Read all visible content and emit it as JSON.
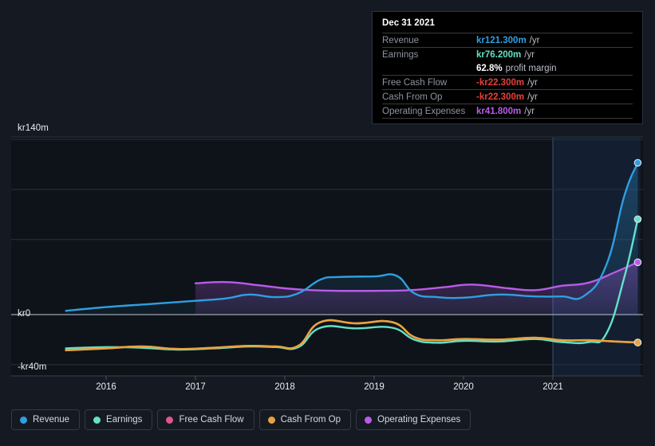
{
  "chart_data": {
    "type": "area",
    "title": "",
    "xlabel": "",
    "ylabel": "",
    "currency_prefix": "kr",
    "unit_suffix": "m",
    "ylim": [
      -40,
      140
    ],
    "xlim": [
      2015.55,
      2021.98
    ],
    "grid": true,
    "y_ticks": [
      {
        "value": 140,
        "label": "kr140m"
      },
      {
        "value": 100,
        "label": ""
      },
      {
        "value": 60,
        "label": ""
      },
      {
        "value": 0,
        "label": "kr0"
      },
      {
        "value": -40,
        "label": "-kr40m"
      }
    ],
    "x_ticks": [
      {
        "value": 2016,
        "label": "2016"
      },
      {
        "value": 2017,
        "label": "2017"
      },
      {
        "value": 2018,
        "label": "2018"
      },
      {
        "value": 2019,
        "label": "2019"
      },
      {
        "value": 2020,
        "label": "2020"
      },
      {
        "value": 2021,
        "label": "2021"
      }
    ],
    "highlight_band": {
      "from": 2021.0,
      "to": 2021.98
    },
    "legend_position": "bottom-left",
    "series": [
      {
        "name": "Revenue",
        "color": "#2E9FE0",
        "x": [
          2015.55,
          2016.0,
          2016.5,
          2017.0,
          2017.35,
          2017.6,
          2017.9,
          2018.15,
          2018.4,
          2018.6,
          2019.0,
          2019.25,
          2019.45,
          2019.7,
          2020.0,
          2020.4,
          2020.8,
          2021.1,
          2021.35,
          2021.6,
          2021.8,
          2021.95
        ],
        "values": [
          3.0,
          6.0,
          8.5,
          11.0,
          13.0,
          16.0,
          14.0,
          17.0,
          28.0,
          30.0,
          30.5,
          31.0,
          17.0,
          14.0,
          13.5,
          16.0,
          14.5,
          14.5,
          15.0,
          40.0,
          95.0,
          121.3
        ]
      },
      {
        "name": "Earnings",
        "color": "#63E2C6",
        "x": [
          2015.55,
          2016.0,
          2016.4,
          2016.8,
          2017.2,
          2017.6,
          2017.9,
          2018.15,
          2018.4,
          2018.8,
          2019.2,
          2019.45,
          2019.7,
          2020.0,
          2020.4,
          2020.8,
          2021.1,
          2021.4,
          2021.6,
          2021.8,
          2021.95
        ],
        "values": [
          -27.0,
          -26.0,
          -26.5,
          -28.0,
          -27.0,
          -25.5,
          -26.0,
          -26.0,
          -10.5,
          -11.0,
          -10.5,
          -20.0,
          -22.5,
          -21.0,
          -21.5,
          -19.5,
          -22.0,
          -22.0,
          -15.0,
          30.0,
          76.2
        ]
      },
      {
        "name": "Free Cash Flow",
        "color": "#E0558F",
        "x": [
          2015.55,
          2016.0,
          2016.4,
          2016.8,
          2017.2,
          2017.6,
          2017.9,
          2018.15,
          2018.4,
          2018.8,
          2019.2,
          2019.45,
          2019.7,
          2020.0,
          2020.4,
          2020.8,
          2021.1,
          2021.4,
          2021.7,
          2021.95
        ],
        "values": [
          -28.5,
          -27.0,
          -25.5,
          -27.5,
          -26.5,
          -25.0,
          -25.5,
          -25.0,
          -6.0,
          -7.0,
          -6.0,
          -18.0,
          -20.5,
          -19.5,
          -20.0,
          -18.5,
          -20.5,
          -20.5,
          -21.5,
          -22.3
        ]
      },
      {
        "name": "Cash From Op",
        "color": "#E8A33D",
        "x": [
          2015.55,
          2016.0,
          2016.4,
          2016.8,
          2017.2,
          2017.6,
          2017.9,
          2018.15,
          2018.4,
          2018.8,
          2019.2,
          2019.45,
          2019.7,
          2020.0,
          2020.4,
          2020.8,
          2021.1,
          2021.4,
          2021.7,
          2021.95
        ],
        "values": [
          -28.5,
          -27.0,
          -25.5,
          -27.5,
          -26.5,
          -25.0,
          -25.5,
          -25.0,
          -6.0,
          -7.0,
          -6.0,
          -18.0,
          -20.5,
          -19.5,
          -20.0,
          -18.5,
          -20.5,
          -20.5,
          -21.5,
          -22.3
        ]
      },
      {
        "name": "Operating Expenses",
        "color": "#B85CE8",
        "x": [
          2017.0,
          2017.35,
          2017.7,
          2018.0,
          2018.3,
          2018.6,
          2019.0,
          2019.4,
          2019.8,
          2020.1,
          2020.5,
          2020.8,
          2021.1,
          2021.4,
          2021.7,
          2021.95
        ],
        "values": [
          25.0,
          26.0,
          23.5,
          21.0,
          19.5,
          19.0,
          19.0,
          19.5,
          22.0,
          24.0,
          21.0,
          19.5,
          23.0,
          25.5,
          34.0,
          41.8
        ]
      }
    ]
  },
  "tooltip": {
    "title": "Dec 31 2021",
    "unit": "/yr",
    "rows": [
      {
        "label": "Revenue",
        "value": "kr121.300m",
        "color": "#2E9FE0",
        "unit": "/yr"
      },
      {
        "label": "Earnings",
        "value": "kr76.200m",
        "color": "#63E2C6",
        "unit": "/yr"
      },
      {
        "label": "",
        "value": "62.8%",
        "color": "#ffffff",
        "sub": "profit margin"
      },
      {
        "label": "Free Cash Flow",
        "value": "-kr22.300m",
        "color": "#E8403A",
        "unit": "/yr"
      },
      {
        "label": "Cash From Op",
        "value": "-kr22.300m",
        "color": "#E8403A",
        "unit": "/yr"
      },
      {
        "label": "Operating Expenses",
        "value": "kr41.800m",
        "color": "#B85CE8",
        "unit": "/yr"
      }
    ]
  },
  "legend": {
    "items": [
      {
        "label": "Revenue",
        "color": "#2E9FE0"
      },
      {
        "label": "Earnings",
        "color": "#63E2C6"
      },
      {
        "label": "Free Cash Flow",
        "color": "#E0558F"
      },
      {
        "label": "Cash From Op",
        "color": "#E8A33D"
      },
      {
        "label": "Operating Expenses",
        "color": "#B85CE8"
      }
    ]
  },
  "axis": {
    "y_top_label": "kr140m",
    "y_zero_label": "kr0",
    "y_bottom_label": "-kr40m"
  },
  "colors": {
    "background": "#151a22",
    "plot_background": "#0e1319",
    "gridline": "#2a323d",
    "zero_line": "#9aa3ae",
    "highlight_band": "#16243a"
  }
}
